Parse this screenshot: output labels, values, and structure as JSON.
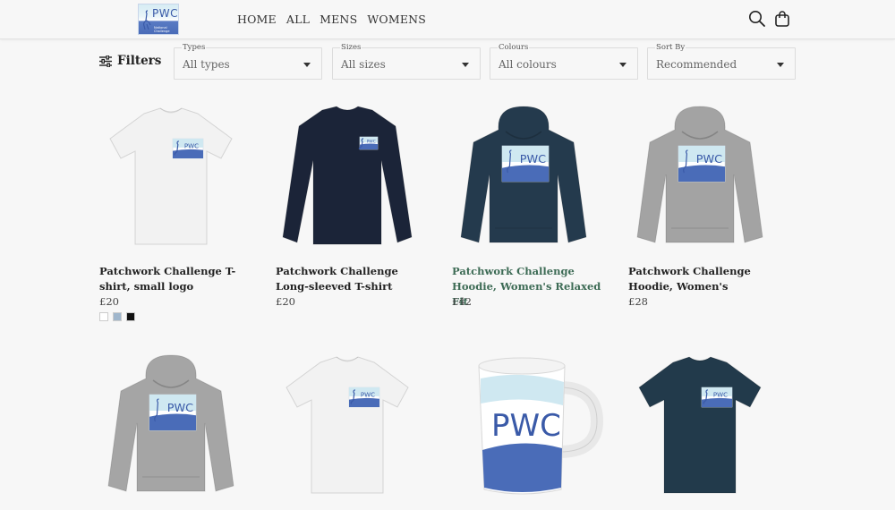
{
  "brand": {
    "logo_text": "PWC",
    "logo_subtitle": "National Challenge"
  },
  "nav": {
    "items": [
      "HOME",
      "ALL",
      "MENS",
      "WOMENS"
    ]
  },
  "header_icons": [
    "search-icon",
    "bag-icon"
  ],
  "filters": {
    "label": "Filters",
    "dropdowns": [
      {
        "label": "Types",
        "value": "All types"
      },
      {
        "label": "Sizes",
        "value": "All sizes"
      },
      {
        "label": "Colours",
        "value": "All colours"
      },
      {
        "label": "Sort By",
        "value": "Recommended"
      }
    ]
  },
  "products": [
    {
      "name": "Patchwork Challenge T-shirt, small logo",
      "price": "£20",
      "garment": "tshirt",
      "color": "#f2f2f2",
      "swatches": [
        "#ffffff",
        "#9fb6cc",
        "#111111"
      ]
    },
    {
      "name": "Patchwork Challenge Long-sleeved T-shirt",
      "price": "£20",
      "garment": "longsleeve",
      "color": "#1b2438",
      "swatches": []
    },
    {
      "name": "Patchwork Challenge Hoodie, Women's Relaxed Fit",
      "price": "£42",
      "garment": "hoodie",
      "color": "#243a4d",
      "swatches": []
    },
    {
      "name": "Patchwork Challenge Hoodie, Women's",
      "price": "£28",
      "garment": "hoodie",
      "color": "#a3a3a3",
      "swatches": []
    },
    {
      "name": "",
      "price": "",
      "garment": "hoodie",
      "color": "#a5a5a5",
      "swatches": []
    },
    {
      "name": "",
      "price": "",
      "garment": "tshirt",
      "color": "#f2f2f2",
      "swatches": []
    },
    {
      "name": "",
      "price": "",
      "garment": "mug",
      "color": "#ffffff",
      "swatches": []
    },
    {
      "name": "",
      "price": "",
      "garment": "tshirt",
      "color": "#223a4b",
      "swatches": []
    }
  ],
  "colors": {
    "background": "#f7f7f7",
    "logo_blue": "#4a6cb8",
    "logo_sky": "#cfe8f1",
    "hover_green": "#3d6b55"
  }
}
